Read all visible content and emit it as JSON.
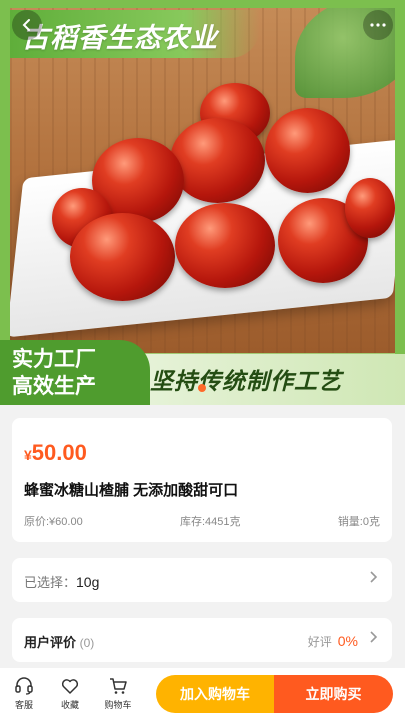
{
  "hero": {
    "brand": "古稻香生态农业",
    "slogan_left_1": "实力工厂",
    "slogan_left_2": "高效生产",
    "slogan_right": "坚持传统制作工艺",
    "back_icon": "chevron-left-icon",
    "more_icon": "more-dots-icon"
  },
  "product": {
    "currency": "¥",
    "price": "50.00",
    "title": "蜂蜜冰糖山楂脯 无添加酸甜可口",
    "original_price": "原价:¥60.00",
    "stock": "库存:4451克",
    "sales": "销量:0克"
  },
  "spec": {
    "label": "已选择：",
    "value": "10g"
  },
  "review": {
    "label": "用户评价",
    "count": "(0)",
    "good_label": "好评",
    "good_value": "0%"
  },
  "bottom_bar": {
    "service": "客服",
    "favorite": "收藏",
    "cart": "购物车",
    "add_to_cart": "加入购物车",
    "buy_now": "立即购买"
  },
  "colors": {
    "accent": "#ff5a1f",
    "cart_button": "#ffb300",
    "brand_green": "#5fae3a"
  }
}
